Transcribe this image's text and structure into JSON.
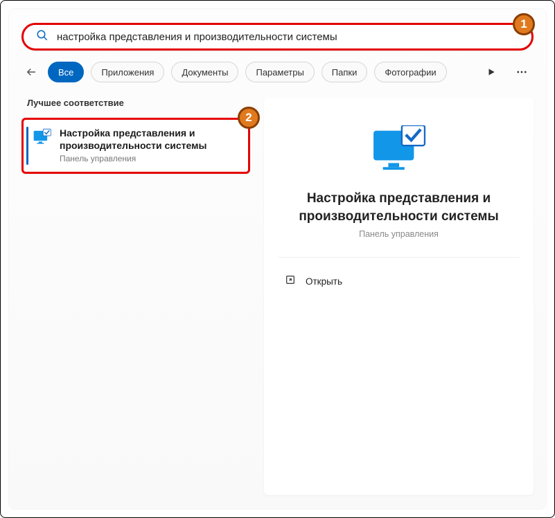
{
  "search": {
    "value": "настройка представления и производительности системы"
  },
  "filters": {
    "items": [
      {
        "label": "Все",
        "active": true
      },
      {
        "label": "Приложения",
        "active": false
      },
      {
        "label": "Документы",
        "active": false
      },
      {
        "label": "Параметры",
        "active": false
      },
      {
        "label": "Папки",
        "active": false
      },
      {
        "label": "Фотографии",
        "active": false
      }
    ]
  },
  "section": {
    "best_match": "Лучшее соответствие"
  },
  "result": {
    "title": "Настройка представления и производительности системы",
    "subtitle": "Панель управления"
  },
  "pane": {
    "title": "Настройка представления и производительности системы",
    "subtitle": "Панель управления",
    "open_label": "Открыть"
  },
  "annotations": {
    "one": "1",
    "two": "2"
  }
}
